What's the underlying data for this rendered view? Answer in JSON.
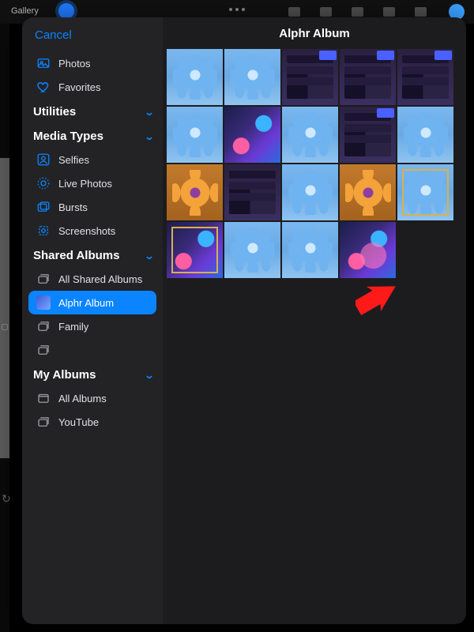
{
  "app": {
    "gallery_label": "Gallery"
  },
  "picker": {
    "cancel": "Cancel",
    "title": "Alphr Album",
    "top_items": [
      {
        "key": "photos",
        "label": "Photos",
        "icon": "photos"
      },
      {
        "key": "favorites",
        "label": "Favorites",
        "icon": "heart"
      }
    ],
    "sections": [
      {
        "title": "Utilities",
        "expanded": true,
        "items": []
      },
      {
        "title": "Media Types",
        "expanded": true,
        "items": [
          {
            "key": "selfies",
            "label": "Selfies",
            "icon": "person-square"
          },
          {
            "key": "livephotos",
            "label": "Live Photos",
            "icon": "livephoto"
          },
          {
            "key": "bursts",
            "label": "Bursts",
            "icon": "burst"
          },
          {
            "key": "screenshots",
            "label": "Screenshots",
            "icon": "screenshot"
          }
        ]
      },
      {
        "title": "Shared Albums",
        "expanded": true,
        "items": [
          {
            "key": "allshared",
            "label": "All Shared Albums",
            "icon": "stack"
          },
          {
            "key": "alphr",
            "label": "Alphr Album",
            "icon": "thumb",
            "selected": true
          },
          {
            "key": "family",
            "label": "Family",
            "icon": "stack"
          },
          {
            "key": "blank",
            "label": "",
            "icon": "stack"
          }
        ]
      },
      {
        "title": "My Albums",
        "expanded": true,
        "items": [
          {
            "key": "allalbums",
            "label": "All Albums",
            "icon": "album"
          },
          {
            "key": "youtube",
            "label": "YouTube",
            "icon": "stack"
          }
        ]
      }
    ]
  },
  "grid": {
    "cols": 5,
    "thumbs": [
      {
        "t": "blue-flower"
      },
      {
        "t": "blue-flower"
      },
      {
        "t": "ui-shot",
        "badge": true
      },
      {
        "t": "ui-shot",
        "badge": true
      },
      {
        "t": "ui-shot",
        "badge": true
      },
      {
        "t": "blue-flower"
      },
      {
        "t": "abstract"
      },
      {
        "t": "blue-flower"
      },
      {
        "t": "ui-shot",
        "badge": true
      },
      {
        "t": "blue-flower"
      },
      {
        "t": "orange-flower"
      },
      {
        "t": "ui-shot"
      },
      {
        "t": "blue-flower"
      },
      {
        "t": "orange-flower"
      },
      {
        "t": "blue-flower",
        "box": true
      },
      {
        "t": "abstract",
        "box": true
      },
      {
        "t": "blue-flower"
      },
      {
        "t": "blue-flower"
      },
      {
        "t": "abstract pink"
      }
    ]
  },
  "annotation": {
    "arrow_color": "#ff1a1a",
    "arrow_target": "below-last-thumb"
  }
}
